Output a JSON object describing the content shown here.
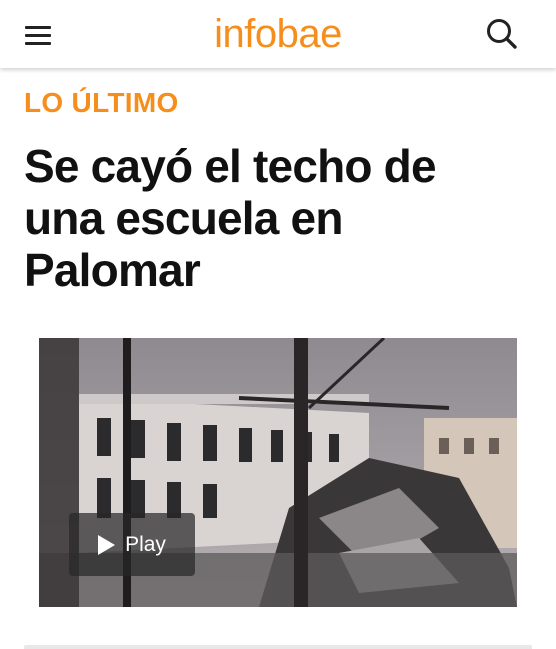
{
  "header": {
    "logo": "infobae",
    "brand_color": "#f68e1e"
  },
  "icons": {
    "menu": "hamburger-menu-icon",
    "search": "search-icon",
    "play": "play-icon"
  },
  "article": {
    "kicker": "LO ÚLTIMO",
    "headline": "Se cayó el techo de una escuela en Palomar"
  },
  "video": {
    "play_label": "Play"
  },
  "colors": {
    "text": "#111111",
    "background": "#ffffff"
  }
}
